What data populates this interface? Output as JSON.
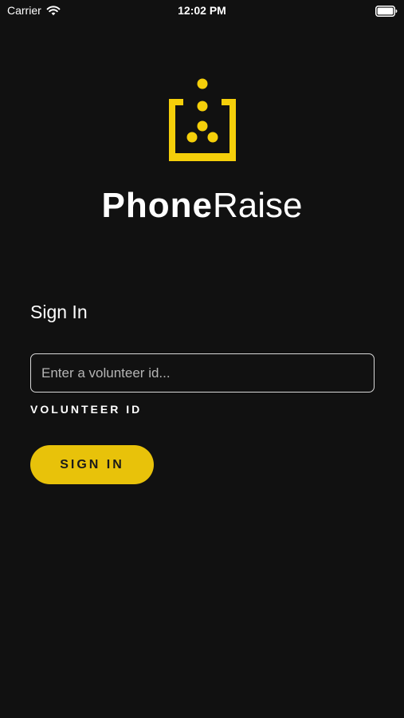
{
  "status_bar": {
    "carrier": "Carrier",
    "time": "12:02 PM",
    "wifi_icon": "wifi-icon",
    "battery_icon": "battery-full-icon"
  },
  "brand": {
    "name_bold": "Phone",
    "name_light": "Raise",
    "logo_icon": "phoneraise-logo-icon",
    "accent_color": "#f5cf0a"
  },
  "form": {
    "heading": "Sign In",
    "volunteer_id": {
      "value": "",
      "placeholder": "Enter a volunteer id...",
      "label": "VOLUNTEER ID"
    },
    "submit_label": "SIGN IN",
    "button_color": "#e8c20a"
  },
  "theme": {
    "background": "#111111",
    "text": "#ffffff"
  }
}
